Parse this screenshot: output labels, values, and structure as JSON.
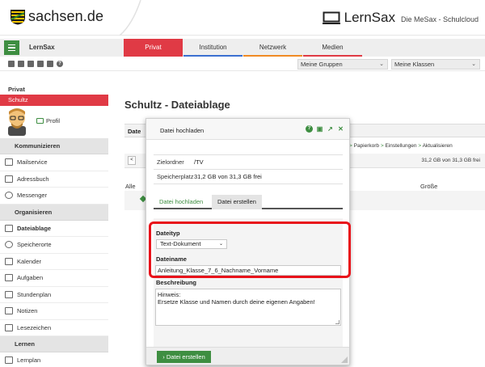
{
  "brand": {
    "sachsen": "sachsen.de",
    "lernsax": "LernSax",
    "lernsax_sub": "Die MeSax - Schulcloud",
    "colors": {
      "accent": "#e03a45",
      "green": "#3e8e41"
    }
  },
  "nav": {
    "brand_label": "LernSax",
    "tabs": [
      {
        "label": "Privat",
        "bar": "#e03a45"
      },
      {
        "label": "Institution",
        "bar": "#3b6fd1"
      },
      {
        "label": "Netzwerk",
        "bar": "#f08a24"
      },
      {
        "label": "Medien",
        "bar": "#e03a45"
      }
    ]
  },
  "toolbar": {
    "groups_select": "Meine Gruppen",
    "classes_select": "Meine Klassen"
  },
  "sidebar": {
    "private_header": "Privat",
    "active_user": "Schultz",
    "profile_label": "Profil",
    "sections": {
      "communicate": "Kommunizieren",
      "organize": "Organisieren",
      "learn": "Lernen"
    },
    "communicate_items": [
      "Mailservice",
      "Adressbuch",
      "Messenger"
    ],
    "organize_items": [
      "Dateiablage",
      "Speicherorte",
      "Kalender",
      "Aufgaben",
      "Stundenplan",
      "Notizen",
      "Lesezeichen"
    ],
    "learn_items": [
      "Lernplan"
    ]
  },
  "main": {
    "title": "Schultz - Dateiablage",
    "strip_label": "Date",
    "links_sep": ">",
    "link_trash": "Papierkorb",
    "link_settings": "Einstellungen",
    "link_refresh": "Aktualisieren",
    "storage": "31,2 GB von 31,3 GB frei",
    "col_all": "Alle",
    "col_size": "Größe"
  },
  "dialog": {
    "title": "Datei hochladen",
    "target_label": "Zielordner",
    "target_value": "/TV",
    "space_label": "Speicherplatz",
    "space_value": "31,2 GB von 31,3 GB frei",
    "tab_upload": "Datei hochladen",
    "tab_create": "Datei erstellen",
    "filetype_label": "Dateityp",
    "filetype_value": "Text-Dokument",
    "filename_label": "Dateiname",
    "filename_value": "Anleitung_Klasse_7_6_Nachname_Vorname",
    "description_label": "Beschreibung",
    "description_value": "Hinweis:\nErsetze Klasse und Namen durch deine eigenen Angaben!",
    "submit": "Datei erstellen"
  }
}
